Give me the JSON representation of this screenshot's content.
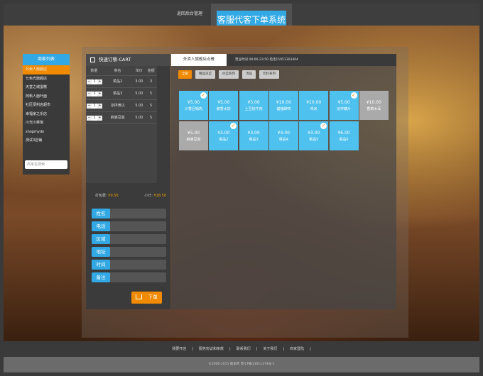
{
  "header": {
    "back_link": "返回后台管理",
    "title": "客服代客下单系统"
  },
  "shop_list": {
    "title": "商家列表",
    "items": [
      "外卖人旗舰店",
      "七色光旗舰店",
      "天堂之城蛋糕",
      "阿帆人面叶面",
      "社区便利店超市",
      "幸福家之乐店",
      "川光川菜馆",
      "shopmydo",
      "测试3店铺"
    ],
    "active_index": 0,
    "search_placeholder": "商家名搜索"
  },
  "cart": {
    "title": "快速订餐-CART",
    "columns": [
      "数量",
      "菜名",
      "单价",
      "金额"
    ],
    "rows": [
      {
        "qty": "1",
        "name": "菜品2",
        "price": "3.00",
        "amount": "3"
      },
      {
        "qty": "1",
        "name": "菜品3",
        "price": "5.00",
        "amount": "5"
      },
      {
        "qty": "1",
        "name": "凉拌黄瓜",
        "price": "5.00",
        "amount": "5"
      },
      {
        "qty": "1",
        "name": "麻婆豆腐",
        "price": "5.00",
        "amount": "5"
      }
    ],
    "packing_label": "打包费:",
    "packing_value": "¥0.50",
    "subtotal_label": "小计:",
    "subtotal_value": "¥18.50",
    "fields": [
      "姓名",
      "电话",
      "区域",
      "地址",
      "时间",
      "备注"
    ],
    "submit_label": "下单"
  },
  "menu": {
    "tab": "外卖人旗舰店点餐",
    "hours": "营业时间 08:00-23:50 电话15051303404",
    "categories": [
      "全部",
      "精品凉菜",
      "炒菜系列",
      "汤品",
      "饮料系列"
    ],
    "active_category": 0,
    "dishes": [
      {
        "price": "¥5.00",
        "name": "川香回锅肉",
        "checked": true,
        "enabled": true
      },
      {
        "price": "¥5.00",
        "name": "酱香水饺",
        "checked": false,
        "enabled": true
      },
      {
        "price": "¥5.00",
        "name": "土豆烧牛肉",
        "checked": false,
        "enabled": true
      },
      {
        "price": "¥10.00",
        "name": "酱猪蹄鸭",
        "checked": false,
        "enabled": true
      },
      {
        "price": "¥10.00",
        "name": "鸡米",
        "checked": false,
        "enabled": true
      },
      {
        "price": "¥5.00",
        "name": "凉拌藕片",
        "checked": true,
        "enabled": true
      },
      {
        "price": "¥10.00",
        "name": "香菜木耳",
        "checked": false,
        "enabled": false
      },
      {
        "price": "¥5.00",
        "name": "麻婆豆腐",
        "checked": false,
        "enabled": false
      },
      {
        "price": "¥3.00",
        "name": "菜品2",
        "checked": true,
        "enabled": true
      },
      {
        "price": "¥3.00",
        "name": "菜品3",
        "checked": false,
        "enabled": true
      },
      {
        "price": "¥4.00",
        "name": "菜品4",
        "checked": false,
        "enabled": true
      },
      {
        "price": "¥3.00",
        "name": "菜品5",
        "checked": true,
        "enabled": true
      },
      {
        "price": "¥6.00",
        "name": "菜品6",
        "checked": false,
        "enabled": true
      }
    ]
  },
  "footer": {
    "links": [
      "我要开店",
      "|",
      "服务协议和条款",
      "|",
      "联系我们",
      "|",
      "关于我们",
      "|",
      "商家登陆",
      "|"
    ],
    "copyright": "©2006-2015 版本所 苏ICP备13011374号-1"
  },
  "colors": {
    "accent": "#32a9e4",
    "orange": "#f08a00"
  }
}
